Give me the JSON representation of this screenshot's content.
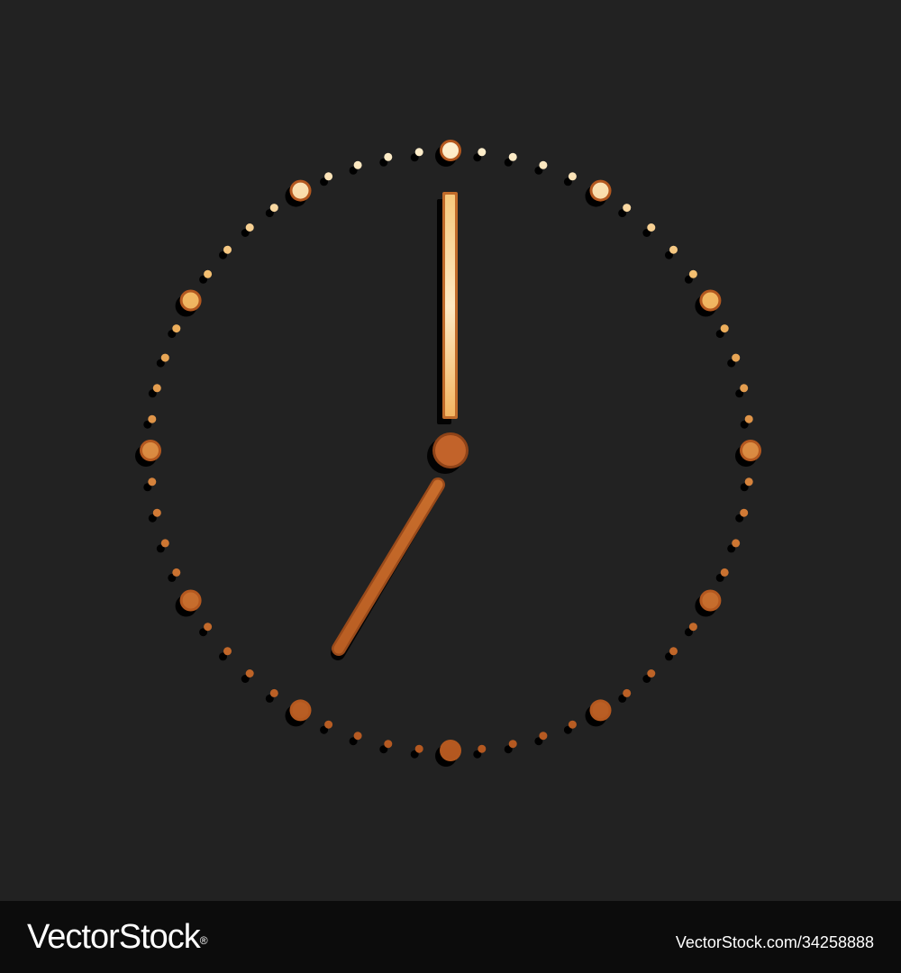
{
  "illustration": {
    "subject": "clock-icon",
    "background_color": "#222222",
    "gradient_colors": [
      "#fff3d6",
      "#f2b863",
      "#d17a35",
      "#b2561f"
    ],
    "shadow_color": "#000000",
    "time_shown": "7:00"
  },
  "watermark": {
    "brand": "VectorStock",
    "registered_mark": "®",
    "image_id": "VectorStock.com/34258888"
  }
}
